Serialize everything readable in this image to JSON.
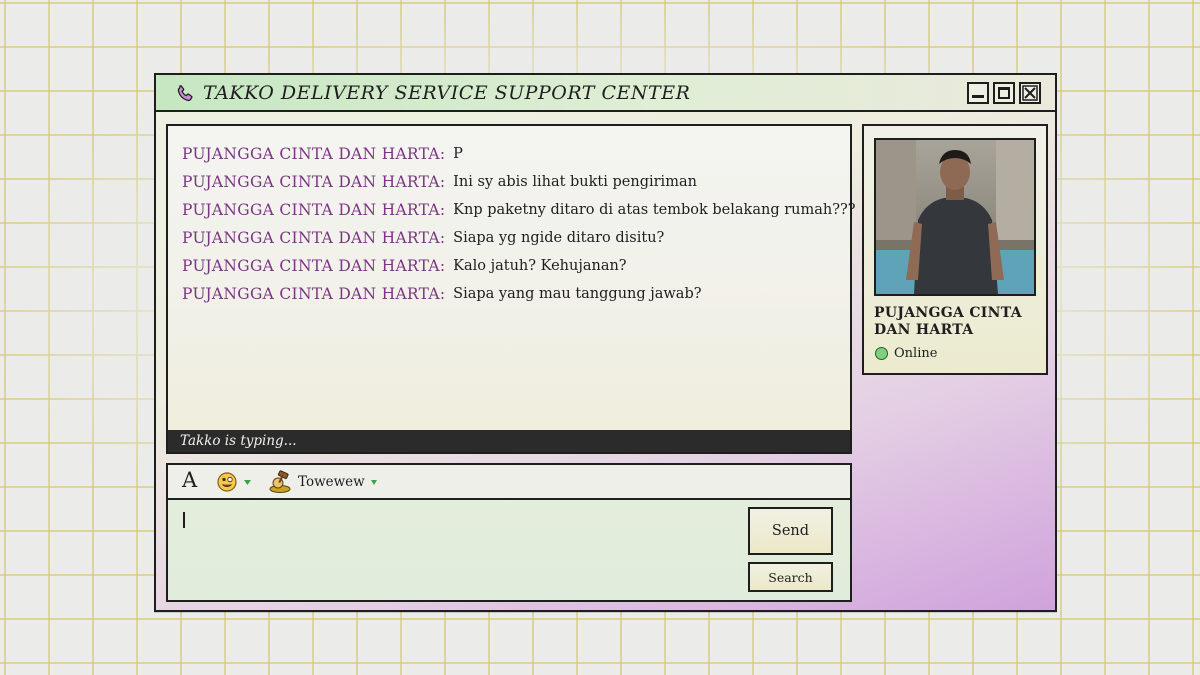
{
  "window": {
    "title": "TAKKO DELIVERY SERVICE SUPPORT CENTER"
  },
  "chat": {
    "messages": [
      {
        "sender": "PUJANGGA CINTA DAN HARTA",
        "text": "P"
      },
      {
        "sender": "PUJANGGA CINTA DAN HARTA",
        "text": "Ini sy abis lihat bukti pengiriman"
      },
      {
        "sender": "PUJANGGA CINTA DAN HARTA",
        "text": "Knp paketny ditaro di atas tembok belakang rumah???"
      },
      {
        "sender": "PUJANGGA CINTA DAN HARTA",
        "text": "Siapa yg ngide ditaro disitu?"
      },
      {
        "sender": "PUJANGGA CINTA DAN HARTA",
        "text": "Kalo jatuh? Kehujanan?"
      },
      {
        "sender": "PUJANGGA CINTA DAN HARTA",
        "text": "Siapa yang mau tanggung jawab?"
      }
    ],
    "typing_status": "Takko is typing..."
  },
  "toolbar": {
    "font_label": "A",
    "emoji_icon": "smiley-face-icon",
    "wink_icon": "gavel-icon",
    "wink_label": "Towewew"
  },
  "composer": {
    "value": "",
    "send_label": "Send",
    "search_label": "Search"
  },
  "profile": {
    "name": "PUJANGGA CINTA DAN HARTA",
    "status": "Online",
    "status_color": "#7fd07a"
  },
  "colors": {
    "sender": "#7b3582",
    "titlebar": "#c6e7c2",
    "window_bottom": "#cfa2dc",
    "typing_bar": "#2b2b2b"
  }
}
